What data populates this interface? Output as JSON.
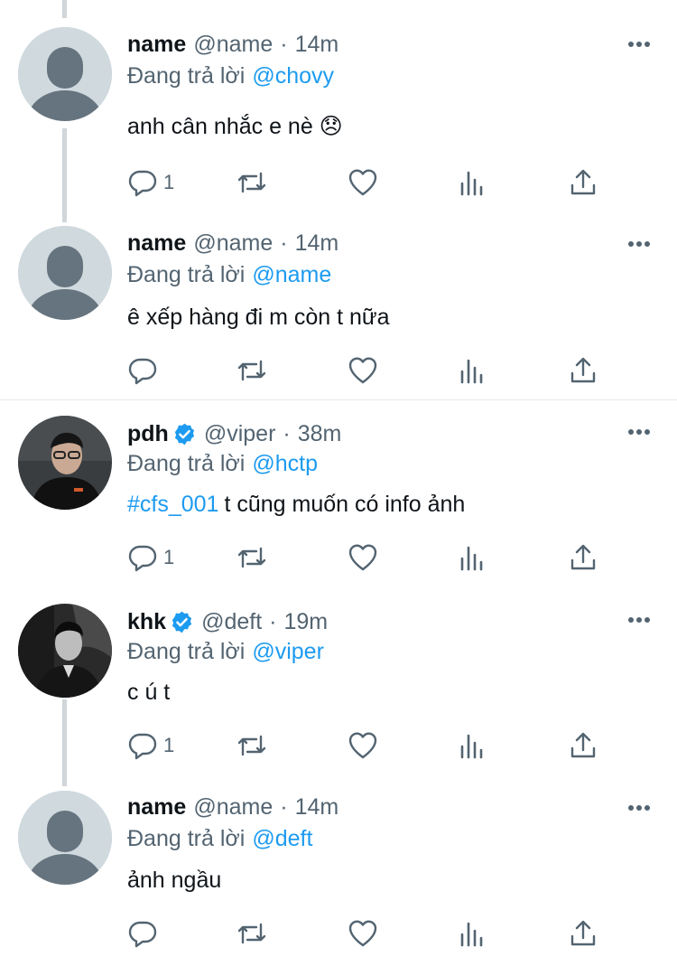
{
  "reply_prefix": "Đang trả lời",
  "tweets": [
    {
      "name": "name",
      "handle": "@name",
      "time": "14m",
      "reply_to": "@chovy",
      "hashtag": "",
      "text": "anh cân nhắc e nè 😞",
      "reply_count": "1"
    },
    {
      "name": "name",
      "handle": "@name",
      "time": "14m",
      "reply_to": "@name",
      "hashtag": "",
      "text": "ê xếp hàng đi m còn t nữa",
      "reply_count": ""
    },
    {
      "name": "pdh",
      "handle": "@viper",
      "time": "38m",
      "reply_to": "@hctp",
      "hashtag": "#cfs_001",
      "text": "t cũng muốn có info ảnh",
      "reply_count": "1"
    },
    {
      "name": "khk",
      "handle": "@deft",
      "time": "19m",
      "reply_to": "@viper",
      "hashtag": "",
      "text": "c ú t",
      "reply_count": "1"
    },
    {
      "name": "name",
      "handle": "@name",
      "time": "14m",
      "reply_to": "@deft",
      "hashtag": "",
      "text": "ảnh ngầu",
      "reply_count": ""
    }
  ],
  "colors": {
    "link": "#1d9bf0",
    "secondary": "#536471",
    "avatar_placeholder": "#cfd9de",
    "thread_line": "#d0d6da"
  }
}
